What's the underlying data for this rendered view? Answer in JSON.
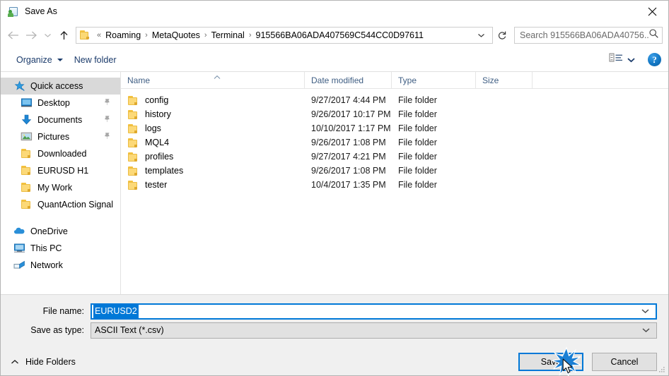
{
  "window": {
    "title": "Save As",
    "title_icon": "save-as-icon",
    "close_icon": "close-icon"
  },
  "navigation": {
    "back_icon": "back-arrow-icon",
    "forward_icon": "forward-arrow-icon",
    "recent_icon": "chevron-down-icon",
    "up_icon": "up-arrow-icon",
    "breadcrumb": {
      "folder_icon": "folder-icon",
      "overflow": "«",
      "separator": "›",
      "items": [
        "Roaming",
        "MetaQuotes",
        "Terminal",
        "915566BA06ADA407569C544CC0D97611"
      ],
      "dropdown_icon": "chevron-down-icon"
    },
    "refresh_icon": "refresh-icon",
    "search": {
      "placeholder": "Search 915566BA06ADA40756...",
      "icon": "search-icon"
    }
  },
  "toolbar": {
    "organize_label": "Organize",
    "new_folder_label": "New folder",
    "view_icon": "view-layout-icon",
    "view_dropdown_icon": "chevron-down-icon",
    "help_icon": "help-icon",
    "help_label": "?"
  },
  "sidebar": {
    "items": [
      {
        "label": "Quick access",
        "icon": "star-pin-icon",
        "selected": true,
        "indent": false,
        "pinned": false
      },
      {
        "label": "Desktop",
        "icon": "desktop-icon",
        "selected": false,
        "indent": true,
        "pinned": true
      },
      {
        "label": "Documents",
        "icon": "documents-icon",
        "selected": false,
        "indent": true,
        "pinned": true
      },
      {
        "label": "Pictures",
        "icon": "pictures-icon",
        "selected": false,
        "indent": true,
        "pinned": true
      },
      {
        "label": "Downloaded",
        "icon": "folder-icon",
        "selected": false,
        "indent": true,
        "pinned": false
      },
      {
        "label": "EURUSD H1",
        "icon": "folder-icon",
        "selected": false,
        "indent": true,
        "pinned": false
      },
      {
        "label": "My Work",
        "icon": "folder-icon",
        "selected": false,
        "indent": true,
        "pinned": false
      },
      {
        "label": "QuantAction Signal",
        "icon": "folder-icon",
        "selected": false,
        "indent": true,
        "pinned": false
      }
    ],
    "items2": [
      {
        "label": "OneDrive",
        "icon": "onedrive-icon",
        "selected": false,
        "indent": false,
        "pinned": false
      },
      {
        "label": "This PC",
        "icon": "thispc-icon",
        "selected": false,
        "indent": false,
        "pinned": false
      },
      {
        "label": "Network",
        "icon": "network-icon",
        "selected": false,
        "indent": false,
        "pinned": false
      }
    ]
  },
  "filelist": {
    "columns": [
      "Name",
      "Date modified",
      "Type",
      "Size"
    ],
    "sort_column": "Name",
    "sort_direction": "ascending",
    "rows": [
      {
        "name": "config",
        "date": "9/27/2017 4:44 PM",
        "type": "File folder",
        "size": ""
      },
      {
        "name": "history",
        "date": "9/26/2017 10:17 PM",
        "type": "File folder",
        "size": ""
      },
      {
        "name": "logs",
        "date": "10/10/2017 1:17 PM",
        "type": "File folder",
        "size": ""
      },
      {
        "name": "MQL4",
        "date": "9/26/2017 1:08 PM",
        "type": "File folder",
        "size": ""
      },
      {
        "name": "profiles",
        "date": "9/27/2017 4:21 PM",
        "type": "File folder",
        "size": ""
      },
      {
        "name": "templates",
        "date": "9/26/2017 1:08 PM",
        "type": "File folder",
        "size": ""
      },
      {
        "name": "tester",
        "date": "10/4/2017 1:35 PM",
        "type": "File folder",
        "size": ""
      }
    ]
  },
  "form": {
    "filename_label": "File name:",
    "filename_value": "EURUSD2",
    "filename_dropdown_icon": "chevron-down-icon",
    "filetype_label": "Save as type:",
    "filetype_value": "ASCII Text (*.csv)",
    "filetype_dropdown_icon": "chevron-down-icon"
  },
  "footer": {
    "hide_folders_label": "Hide Folders",
    "hide_folders_icon": "chevron-up-icon",
    "save_label": "Save",
    "cancel_label": "Cancel",
    "resize_grip_icon": "resize-grip-icon",
    "click_effect_icon": "click-burst-icon",
    "cursor_icon": "mouse-cursor-icon"
  },
  "colors": {
    "accent": "#0078d7",
    "folder": "#fcd978",
    "selection": "#d9d9d9",
    "chrome": "#f0f0f0"
  }
}
